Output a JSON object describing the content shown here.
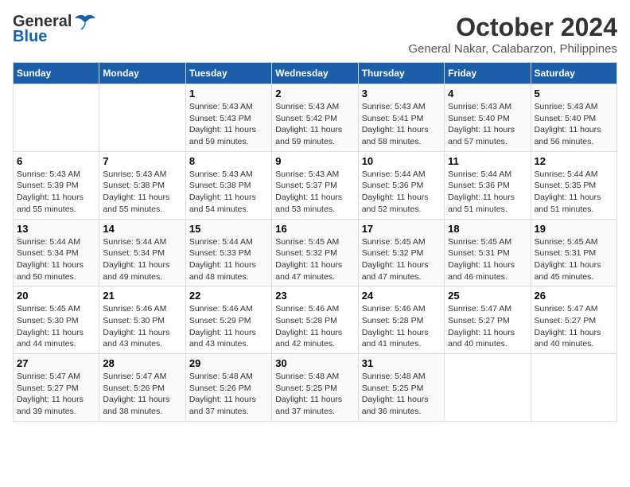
{
  "header": {
    "logo_general": "General",
    "logo_blue": "Blue",
    "month_title": "October 2024",
    "location": "General Nakar, Calabarzon, Philippines"
  },
  "columns": [
    "Sunday",
    "Monday",
    "Tuesday",
    "Wednesday",
    "Thursday",
    "Friday",
    "Saturday"
  ],
  "weeks": [
    [
      {
        "day": "",
        "sunrise": "",
        "sunset": "",
        "daylight": ""
      },
      {
        "day": "",
        "sunrise": "",
        "sunset": "",
        "daylight": ""
      },
      {
        "day": "1",
        "sunrise": "Sunrise: 5:43 AM",
        "sunset": "Sunset: 5:43 PM",
        "daylight": "Daylight: 11 hours and 59 minutes."
      },
      {
        "day": "2",
        "sunrise": "Sunrise: 5:43 AM",
        "sunset": "Sunset: 5:42 PM",
        "daylight": "Daylight: 11 hours and 59 minutes."
      },
      {
        "day": "3",
        "sunrise": "Sunrise: 5:43 AM",
        "sunset": "Sunset: 5:41 PM",
        "daylight": "Daylight: 11 hours and 58 minutes."
      },
      {
        "day": "4",
        "sunrise": "Sunrise: 5:43 AM",
        "sunset": "Sunset: 5:40 PM",
        "daylight": "Daylight: 11 hours and 57 minutes."
      },
      {
        "day": "5",
        "sunrise": "Sunrise: 5:43 AM",
        "sunset": "Sunset: 5:40 PM",
        "daylight": "Daylight: 11 hours and 56 minutes."
      }
    ],
    [
      {
        "day": "6",
        "sunrise": "Sunrise: 5:43 AM",
        "sunset": "Sunset: 5:39 PM",
        "daylight": "Daylight: 11 hours and 55 minutes."
      },
      {
        "day": "7",
        "sunrise": "Sunrise: 5:43 AM",
        "sunset": "Sunset: 5:38 PM",
        "daylight": "Daylight: 11 hours and 55 minutes."
      },
      {
        "day": "8",
        "sunrise": "Sunrise: 5:43 AM",
        "sunset": "Sunset: 5:38 PM",
        "daylight": "Daylight: 11 hours and 54 minutes."
      },
      {
        "day": "9",
        "sunrise": "Sunrise: 5:43 AM",
        "sunset": "Sunset: 5:37 PM",
        "daylight": "Daylight: 11 hours and 53 minutes."
      },
      {
        "day": "10",
        "sunrise": "Sunrise: 5:44 AM",
        "sunset": "Sunset: 5:36 PM",
        "daylight": "Daylight: 11 hours and 52 minutes."
      },
      {
        "day": "11",
        "sunrise": "Sunrise: 5:44 AM",
        "sunset": "Sunset: 5:36 PM",
        "daylight": "Daylight: 11 hours and 51 minutes."
      },
      {
        "day": "12",
        "sunrise": "Sunrise: 5:44 AM",
        "sunset": "Sunset: 5:35 PM",
        "daylight": "Daylight: 11 hours and 51 minutes."
      }
    ],
    [
      {
        "day": "13",
        "sunrise": "Sunrise: 5:44 AM",
        "sunset": "Sunset: 5:34 PM",
        "daylight": "Daylight: 11 hours and 50 minutes."
      },
      {
        "day": "14",
        "sunrise": "Sunrise: 5:44 AM",
        "sunset": "Sunset: 5:34 PM",
        "daylight": "Daylight: 11 hours and 49 minutes."
      },
      {
        "day": "15",
        "sunrise": "Sunrise: 5:44 AM",
        "sunset": "Sunset: 5:33 PM",
        "daylight": "Daylight: 11 hours and 48 minutes."
      },
      {
        "day": "16",
        "sunrise": "Sunrise: 5:45 AM",
        "sunset": "Sunset: 5:32 PM",
        "daylight": "Daylight: 11 hours and 47 minutes."
      },
      {
        "day": "17",
        "sunrise": "Sunrise: 5:45 AM",
        "sunset": "Sunset: 5:32 PM",
        "daylight": "Daylight: 11 hours and 47 minutes."
      },
      {
        "day": "18",
        "sunrise": "Sunrise: 5:45 AM",
        "sunset": "Sunset: 5:31 PM",
        "daylight": "Daylight: 11 hours and 46 minutes."
      },
      {
        "day": "19",
        "sunrise": "Sunrise: 5:45 AM",
        "sunset": "Sunset: 5:31 PM",
        "daylight": "Daylight: 11 hours and 45 minutes."
      }
    ],
    [
      {
        "day": "20",
        "sunrise": "Sunrise: 5:45 AM",
        "sunset": "Sunset: 5:30 PM",
        "daylight": "Daylight: 11 hours and 44 minutes."
      },
      {
        "day": "21",
        "sunrise": "Sunrise: 5:46 AM",
        "sunset": "Sunset: 5:30 PM",
        "daylight": "Daylight: 11 hours and 43 minutes."
      },
      {
        "day": "22",
        "sunrise": "Sunrise: 5:46 AM",
        "sunset": "Sunset: 5:29 PM",
        "daylight": "Daylight: 11 hours and 43 minutes."
      },
      {
        "day": "23",
        "sunrise": "Sunrise: 5:46 AM",
        "sunset": "Sunset: 5:28 PM",
        "daylight": "Daylight: 11 hours and 42 minutes."
      },
      {
        "day": "24",
        "sunrise": "Sunrise: 5:46 AM",
        "sunset": "Sunset: 5:28 PM",
        "daylight": "Daylight: 11 hours and 41 minutes."
      },
      {
        "day": "25",
        "sunrise": "Sunrise: 5:47 AM",
        "sunset": "Sunset: 5:27 PM",
        "daylight": "Daylight: 11 hours and 40 minutes."
      },
      {
        "day": "26",
        "sunrise": "Sunrise: 5:47 AM",
        "sunset": "Sunset: 5:27 PM",
        "daylight": "Daylight: 11 hours and 40 minutes."
      }
    ],
    [
      {
        "day": "27",
        "sunrise": "Sunrise: 5:47 AM",
        "sunset": "Sunset: 5:27 PM",
        "daylight": "Daylight: 11 hours and 39 minutes."
      },
      {
        "day": "28",
        "sunrise": "Sunrise: 5:47 AM",
        "sunset": "Sunset: 5:26 PM",
        "daylight": "Daylight: 11 hours and 38 minutes."
      },
      {
        "day": "29",
        "sunrise": "Sunrise: 5:48 AM",
        "sunset": "Sunset: 5:26 PM",
        "daylight": "Daylight: 11 hours and 37 minutes."
      },
      {
        "day": "30",
        "sunrise": "Sunrise: 5:48 AM",
        "sunset": "Sunset: 5:25 PM",
        "daylight": "Daylight: 11 hours and 37 minutes."
      },
      {
        "day": "31",
        "sunrise": "Sunrise: 5:48 AM",
        "sunset": "Sunset: 5:25 PM",
        "daylight": "Daylight: 11 hours and 36 minutes."
      },
      {
        "day": "",
        "sunrise": "",
        "sunset": "",
        "daylight": ""
      },
      {
        "day": "",
        "sunrise": "",
        "sunset": "",
        "daylight": ""
      }
    ]
  ]
}
